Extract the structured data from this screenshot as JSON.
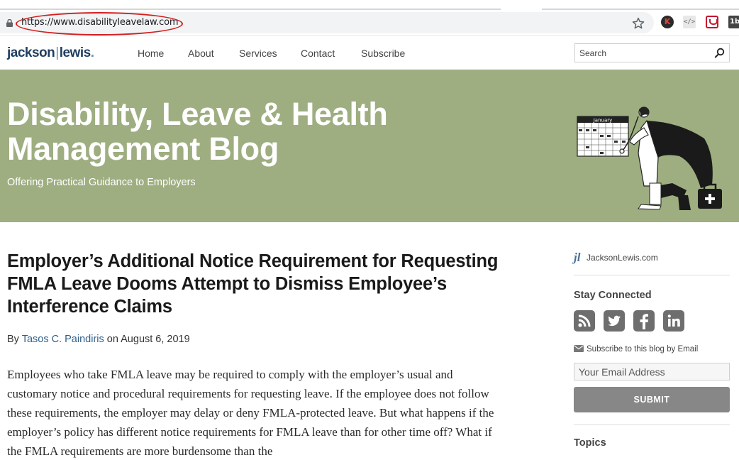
{
  "browser": {
    "url": "https://www.disabilityleavelaw.com",
    "extensions": [
      {
        "name": "kaspersky-icon",
        "label": "K"
      },
      {
        "name": "code-icon",
        "label": "</>"
      },
      {
        "name": "pocket-icon",
        "label": ""
      },
      {
        "name": "1b-icon",
        "label": "1b"
      }
    ]
  },
  "header": {
    "logo_left": "jackson",
    "logo_right": "lewis",
    "logo_dot": ".",
    "nav": [
      "Home",
      "About",
      "Services",
      "Contact",
      "Subscribe"
    ],
    "search_placeholder": "Search"
  },
  "hero": {
    "title": "Disability, Leave & Health Management Blog",
    "subtitle": "Offering Practical Guidance to Employers",
    "calendar_month": "January",
    "background_color": "#9eae80"
  },
  "article": {
    "title": "Employer’s Additional Notice Requirement for Requesting FMLA Leave Dooms Attempt to Dismiss Employee’s Interference Claims",
    "byline_prefix": "By ",
    "author": "Tasos C. Paindiris",
    "byline_mid": " on ",
    "date": "August 6, 2019",
    "body": "Employees who take FMLA leave may be required to comply with the employer’s usual and customary notice and procedural requirements for requesting leave. If the employee does not follow these requirements, the employer may delay or deny FMLA-protected leave.  But what happens if the employer’s policy has different notice requirements for FMLA leave than for other time off?  What if the FMLA requirements are more burdensome than the"
  },
  "sidebar": {
    "jl_mark": "jl",
    "jl_link": "JacksonLewis.com",
    "stay_connected": "Stay Connected",
    "social": [
      "rss-icon",
      "twitter-icon",
      "facebook-icon",
      "linkedin-icon"
    ],
    "subscribe_label": "Subscribe to this blog by Email",
    "email_placeholder": "Your Email Address",
    "submit_label": "SUBMIT",
    "topics": "Topics"
  }
}
